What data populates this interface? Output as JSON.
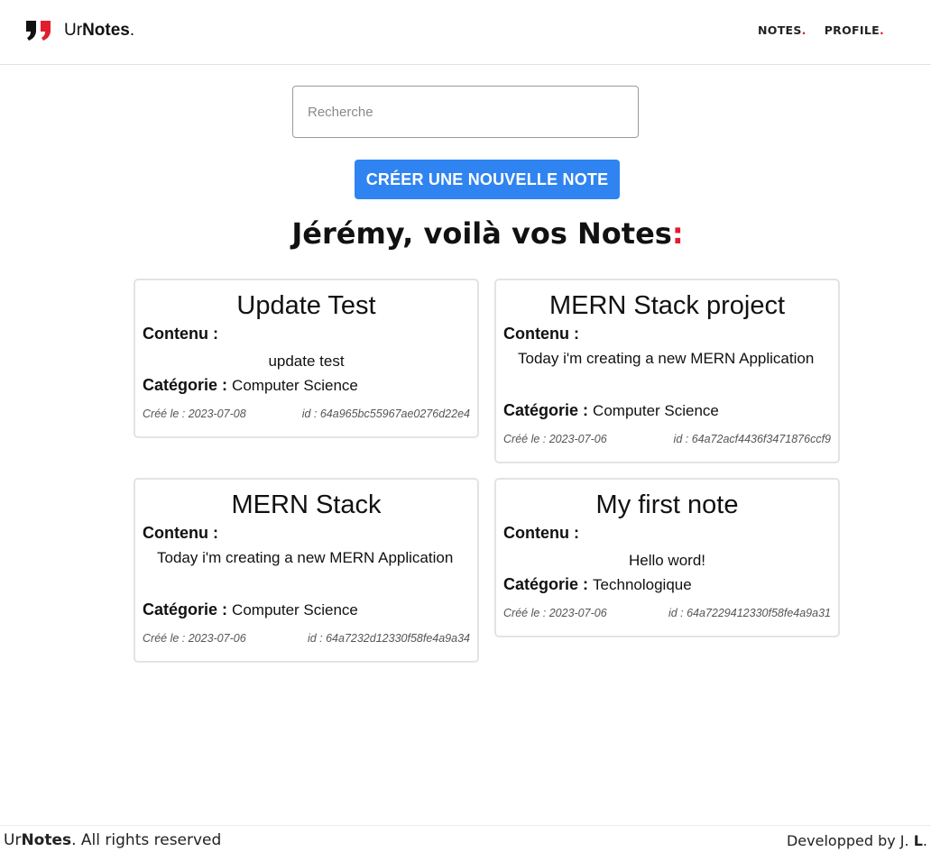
{
  "header": {
    "brand_prefix": "Ur",
    "brand_bold": "Notes",
    "brand_dot": ".",
    "nav": [
      {
        "label": "NOTES",
        "dot": "."
      },
      {
        "label": "PROFILE",
        "dot": "."
      }
    ]
  },
  "search": {
    "placeholder": "Recherche",
    "value": ""
  },
  "create_button": {
    "label": "CRÉER UNE NOUVELLE NOTE"
  },
  "heading": {
    "prefix": "Jérémy, voilà vos ",
    "bold": "Notes",
    "suffix": ":"
  },
  "labels": {
    "content": "Contenu :",
    "category": "Catégorie :"
  },
  "notes": [
    {
      "title": "Update Test",
      "content": "update test",
      "category": "Computer Science",
      "created": "Créé le : 2023-07-08",
      "id": "id : 64a965bc55967ae0276d22e4"
    },
    {
      "title": "MERN Stack project",
      "content": "Today i'm creating a new MERN Application",
      "category": "Computer Science",
      "created": "Créé le : 2023-07-06",
      "id": "id : 64a72acf4436f3471876ccf9"
    },
    {
      "title": "MERN Stack",
      "content": "Today i'm creating a new MERN Application",
      "category": "Computer Science",
      "created": "Créé le : 2023-07-06",
      "id": "id : 64a7232d12330f58fe4a9a34"
    },
    {
      "title": "My first note",
      "content": "Hello word!",
      "category": "Technologique",
      "created": "Créé le : 2023-07-06",
      "id": "id : 64a7229412330f58fe4a9a31"
    }
  ],
  "footer": {
    "left_prefix": "Ur",
    "left_bold": "Notes",
    "left_suffix": ". All rights reserved",
    "right_prefix": "Developped by J. ",
    "right_bold": "L",
    "right_suffix": "."
  },
  "colors": {
    "accent": "#2f84f1",
    "brand_red": "#e11d2e"
  }
}
